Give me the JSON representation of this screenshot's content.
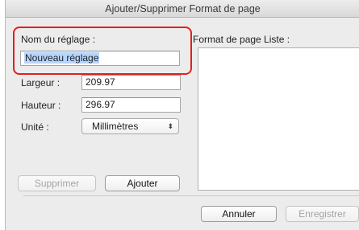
{
  "window": {
    "title": "Ajouter/Supprimer Format de page"
  },
  "settings": {
    "name_label": "Nom du réglage :",
    "name_value": "Nouveau réglage",
    "width_label": "Largeur :",
    "width_value": "209.97",
    "height_label": "Hauteur :",
    "height_value": "296.97",
    "unit_label": "Unité :",
    "unit_value": "Millimètres"
  },
  "list": {
    "label": "Format de page Liste :",
    "items": []
  },
  "buttons": {
    "delete": "Supprimer",
    "add": "Ajouter",
    "cancel": "Annuler",
    "save": "Enregistrer"
  },
  "colors": {
    "highlight": "#e02020",
    "selection": "#b5d5ff"
  },
  "icons": {
    "popup_arrows": "up-down-arrows-icon"
  }
}
